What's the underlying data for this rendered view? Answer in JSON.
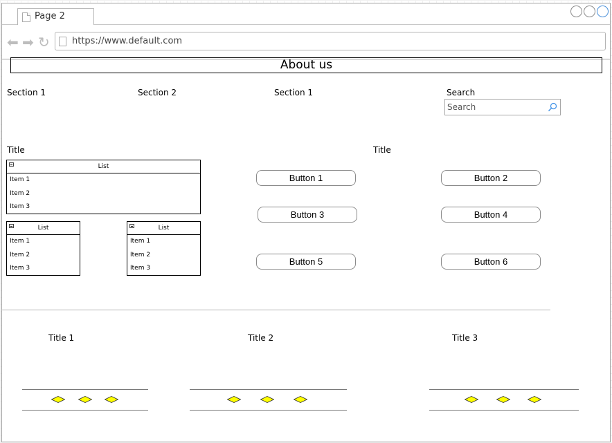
{
  "browser": {
    "tab_label": "Page 2",
    "url": "https://www.default.com"
  },
  "header": {
    "title": "About us"
  },
  "nav": {
    "section_a": "Section 1",
    "section_b": "Section 2",
    "section_c": "Section 1",
    "search_label": "Search",
    "search_placeholder": "Search"
  },
  "left": {
    "title": "Title",
    "main_list": {
      "header": "List",
      "items": [
        "Item 1",
        "Item 2",
        "Item 3"
      ]
    },
    "small_list_1": {
      "header": "List",
      "items": [
        "Item 1",
        "Item 2",
        "Item 3"
      ]
    },
    "small_list_2": {
      "header": "List",
      "items": [
        "Item 1",
        "Item 2",
        "Item 3"
      ]
    }
  },
  "right": {
    "title": "Title"
  },
  "buttons": [
    "Button 1",
    "Button 2",
    "Button 3",
    "Button 4",
    "Button 5",
    "Button 6"
  ],
  "footer": {
    "titles": [
      "Title 1",
      "Title 2",
      "Title 3"
    ]
  },
  "colors": {
    "diamond_fill": "#ffff00",
    "diamond_stroke": "#333333",
    "window_active": "#4a90d9"
  }
}
